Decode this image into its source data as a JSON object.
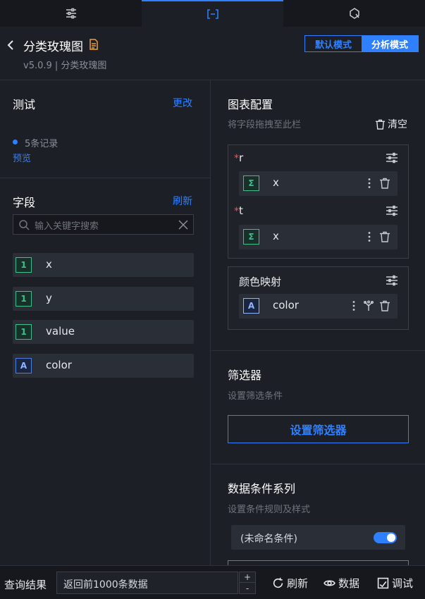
{
  "tabs": [
    {
      "icon": "sliders-icon"
    },
    {
      "icon": "bracket-icon"
    },
    {
      "icon": "gem-icon"
    }
  ],
  "header": {
    "title": "分类玫瑰图",
    "subtitle": "v5.0.9 | 分类玫瑰图",
    "mode_default": "默认模式",
    "mode_analysis": "分析模式"
  },
  "test": {
    "title": "测试",
    "change": "更改",
    "records": "5条记录",
    "preview": "预览"
  },
  "fields": {
    "title": "字段",
    "refresh": "刷新",
    "search_placeholder": "输入关键字搜索",
    "items": [
      {
        "type": "1",
        "name": "x"
      },
      {
        "type": "1",
        "name": "y"
      },
      {
        "type": "1",
        "name": "value"
      },
      {
        "type": "A",
        "name": "color"
      }
    ]
  },
  "config": {
    "title": "图表配置",
    "hint": "将字段拖拽至此栏",
    "clear": "清空",
    "r_label": "r",
    "r_field": "x",
    "t_label": "t",
    "t_field": "x",
    "color_label": "颜色映射",
    "color_field": "color",
    "sum_glyph": "Σ",
    "str_glyph": "A",
    "required_mark": "*"
  },
  "filter": {
    "title": "筛选器",
    "hint": "设置筛选条件",
    "button": "设置筛选器"
  },
  "conditions": {
    "title": "数据条件系列",
    "hint": "设置条件规则及样式",
    "item": "(未命名条件)"
  },
  "footer": {
    "label": "查询结果",
    "limit": "返回前1000条数据",
    "plus": "+",
    "minus": "-",
    "refresh": "刷新",
    "data": "数据",
    "debug": "调试"
  },
  "colors": {
    "accent": "#2f80ff",
    "number_badge": "#3dbf8a",
    "string_badge": "#4d7ee0",
    "required": "#ff4d4f"
  }
}
